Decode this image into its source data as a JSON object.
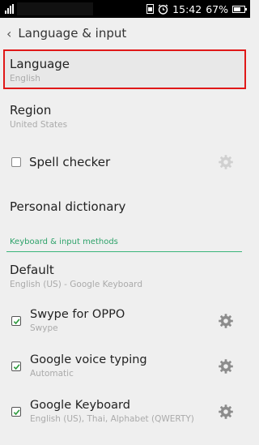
{
  "status": {
    "time": "15:42",
    "battery": "67%",
    "battery_level": 0.67
  },
  "header": {
    "title": "Language & input"
  },
  "items": {
    "language": {
      "title": "Language",
      "subtitle": "English"
    },
    "region": {
      "title": "Region",
      "subtitle": "United States"
    },
    "spell_checker": {
      "title": "Spell checker",
      "checked": false
    },
    "personal_dictionary": {
      "title": "Personal dictionary"
    }
  },
  "section": {
    "keyboard_header": "Keyboard & input methods"
  },
  "keyboards": {
    "default": {
      "title": "Default",
      "subtitle": "English (US) - Google Keyboard"
    },
    "swype": {
      "title": "Swype for OPPO",
      "subtitle": "Swype",
      "checked": true
    },
    "google_voice": {
      "title": "Google voice typing",
      "subtitle": "Automatic",
      "checked": true
    },
    "google_keyboard": {
      "title": "Google Keyboard",
      "subtitle": "English (US), Thai, Alphabet (QWERTY)",
      "checked": true
    }
  },
  "colors": {
    "accent": "#2ea26a",
    "highlight_border": "#e01818"
  }
}
